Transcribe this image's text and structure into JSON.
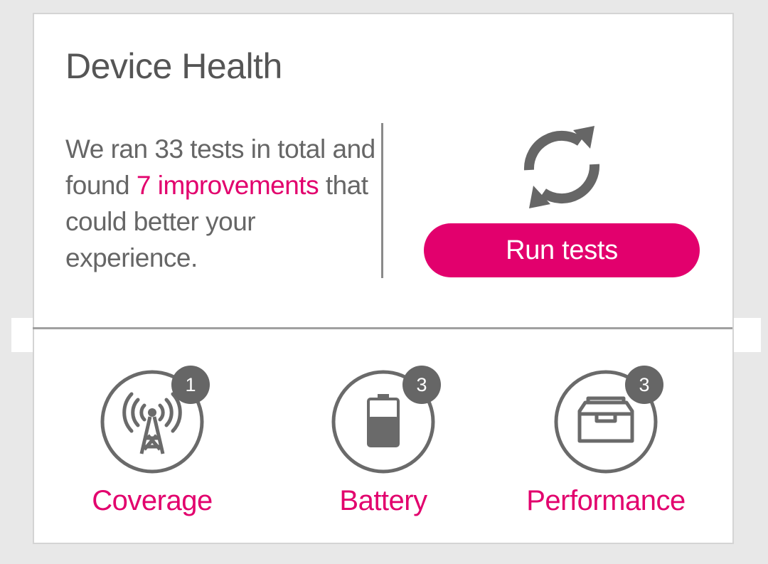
{
  "card": {
    "title": "Device Health",
    "summary_prefix": "We ran 33 tests in total and found ",
    "summary_highlight": "7 improvements",
    "summary_suffix": " that could better your experience.",
    "run_button_label": "Run tests",
    "refresh_icon": "refresh-icon"
  },
  "categories": [
    {
      "label": "Coverage",
      "badge": "1",
      "icon": "signal-tower-icon"
    },
    {
      "label": "Battery",
      "badge": "3",
      "icon": "battery-icon"
    },
    {
      "label": "Performance",
      "badge": "3",
      "icon": "toolbox-icon"
    }
  ],
  "colors": {
    "accent": "#e2006d",
    "text": "#666666",
    "icon": "#666666",
    "background": "#e8e8e8"
  }
}
